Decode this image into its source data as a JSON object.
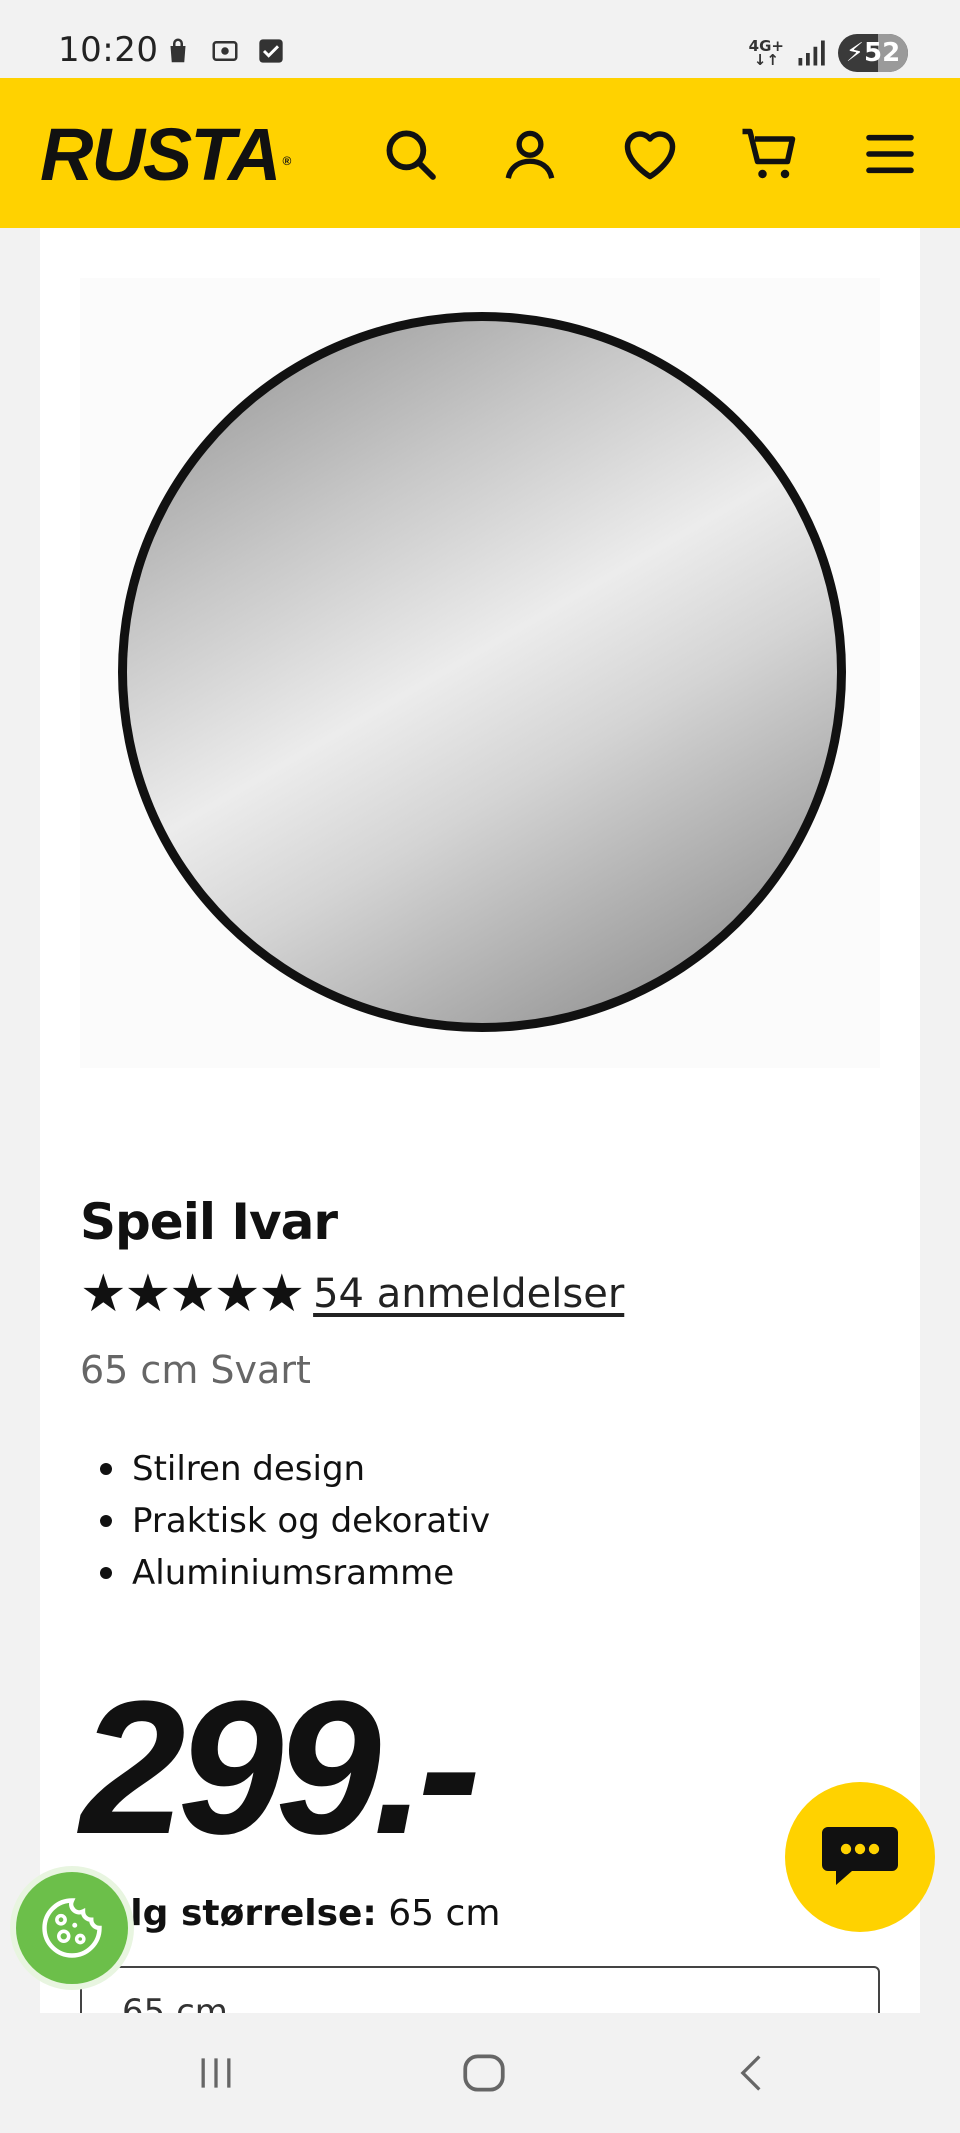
{
  "status_bar": {
    "time": "10:20",
    "network": "4G+",
    "battery": "52"
  },
  "header": {
    "logo": "RUSTA",
    "brand_color": "#ffd200",
    "icons": [
      "search-icon",
      "account-icon",
      "wishlist-icon",
      "cart-icon",
      "menu-icon"
    ]
  },
  "product": {
    "title": "Speil Ivar",
    "stars": "★★★★★",
    "rating": 5,
    "reviews": "54 anmeldelser",
    "variant": "65 cm Svart",
    "features": [
      "Stilren design",
      "Praktisk og dekorativ",
      "Aluminiumsramme"
    ],
    "price": "299.-",
    "size_label": "Velg størrelse:",
    "size_value": "65 cm",
    "size_select_value": "65 cm"
  },
  "floating": {
    "chat_color": "#ffd200",
    "cookie_color": "#6cbf4a"
  }
}
